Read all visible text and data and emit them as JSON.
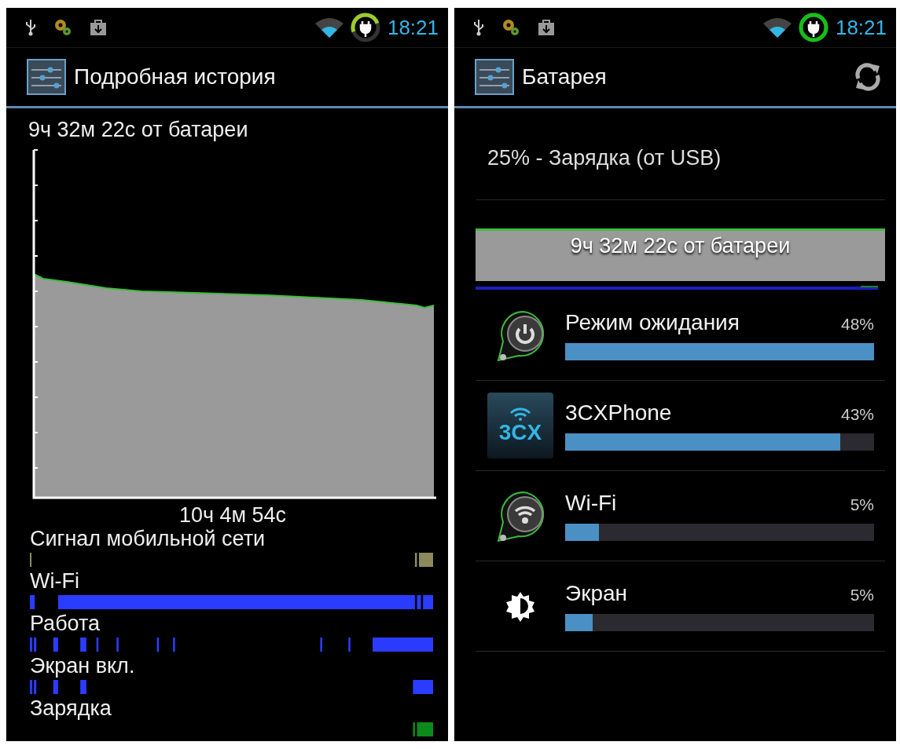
{
  "history_screen": {
    "status_bar": {
      "time": "18:21"
    },
    "title": "Подробная история",
    "on_battery": "9ч 32м 22с от батареи",
    "graph_duration": "10ч 4м 54с",
    "tracks": [
      {
        "label": "Сигнал мобильной сети",
        "color": "#8c8a5c"
      },
      {
        "label": "Wi-Fi",
        "color": "#2a3cff"
      },
      {
        "label": "Работа",
        "color": "#2a3cff"
      },
      {
        "label": "Экран вкл.",
        "color": "#2a3cff"
      },
      {
        "label": "Зарядка",
        "color": "#0c8a1a"
      }
    ]
  },
  "battery_screen": {
    "status_bar": {
      "time": "18:21"
    },
    "title": "Батарея",
    "charge_status": "25% - Зарядка (от USB)",
    "graph_label": "9ч 32м 22с от батареи",
    "apps": [
      {
        "kind": "standby",
        "name": "Режим ожидания",
        "percent": "48%",
        "level": 1.0
      },
      {
        "kind": "app",
        "name": "3CXPhone",
        "icon_text": "3CX",
        "percent": "43%",
        "level": 0.89
      },
      {
        "kind": "wifi",
        "name": "Wi-Fi",
        "percent": "5%",
        "level": 0.11
      },
      {
        "kind": "screen",
        "name": "Экран",
        "percent": "5%",
        "level": 0.09
      }
    ]
  }
}
